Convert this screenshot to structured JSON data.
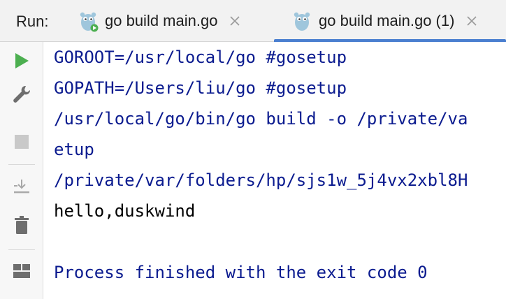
{
  "run_panel": {
    "label": "Run:",
    "tabs": [
      {
        "title": "go build main.go",
        "active": false
      },
      {
        "title": "go build main.go (1)",
        "active": true
      }
    ]
  },
  "toolbar": {
    "icons": [
      "rerun-icon",
      "wrench-icon",
      "stop-icon",
      "scroll-to-end-icon",
      "trash-icon",
      "layout-icon"
    ]
  },
  "console": {
    "lines": [
      {
        "text": "GOROOT=/usr/local/go #gosetup",
        "kind": "system"
      },
      {
        "text": "GOPATH=/Users/liu/go #gosetup",
        "kind": "system"
      },
      {
        "text": "/usr/local/go/bin/go build -o /private/va",
        "kind": "system"
      },
      {
        "text": "etup",
        "kind": "system"
      },
      {
        "text": "/private/var/folders/hp/sjs1w_5j4vx2xbl8H",
        "kind": "system"
      },
      {
        "text": "hello,duskwind",
        "kind": "output"
      },
      {
        "text": "",
        "kind": "output"
      },
      {
        "text": "Process finished with the exit code 0",
        "kind": "system"
      }
    ]
  },
  "colors": {
    "system_text": "#0b1b8f",
    "output_text": "#000000",
    "run_green": "#4caf50",
    "active_tab_underline": "#4a7fd0"
  }
}
